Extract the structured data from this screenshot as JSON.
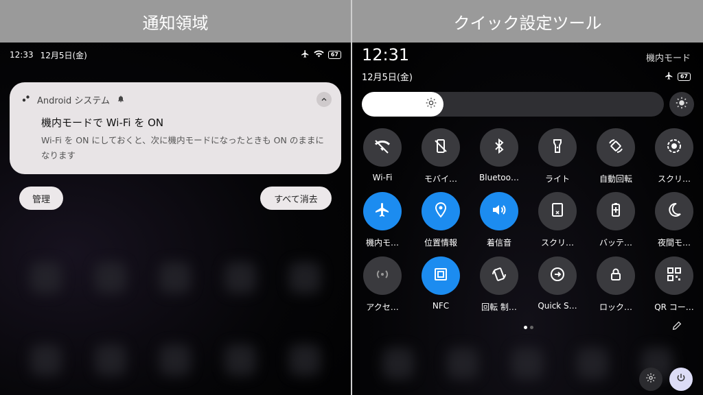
{
  "headers": {
    "left": "通知領域",
    "right": "クイック設定ツール"
  },
  "left_panel": {
    "status_bar": {
      "time": "12:33",
      "date": "12月5日(金)",
      "battery": "67"
    },
    "notification": {
      "app_name": "Android システム",
      "title": "機内モードで Wi-Fi を ON",
      "body": "Wi-Fi を ON にしておくと、次に機内モードになったときも ON のままになります"
    },
    "buttons": {
      "manage": "管理",
      "clear_all": "すべて消去"
    }
  },
  "right_panel": {
    "time": "12:31",
    "mode": "機内モード",
    "date": "12月5日(金)",
    "battery": "67",
    "brightness_level": 0.27,
    "tiles": [
      {
        "label": "Wi-Fi",
        "icon": "wifi-off-icon",
        "active": false
      },
      {
        "label": "モバイ…",
        "icon": "mobile-data-off-icon",
        "active": false
      },
      {
        "label": "Bluetoo…",
        "icon": "bluetooth-icon",
        "active": false
      },
      {
        "label": "ライト",
        "icon": "flashlight-icon",
        "active": false
      },
      {
        "label": "自動回転",
        "icon": "auto-rotate-icon",
        "active": false
      },
      {
        "label": "スクリ…",
        "icon": "screen-record-icon",
        "active": false
      },
      {
        "label": "機内モ…",
        "icon": "airplane-icon",
        "active": true
      },
      {
        "label": "位置情報",
        "icon": "location-icon",
        "active": true
      },
      {
        "label": "着信音",
        "icon": "sound-icon",
        "active": true
      },
      {
        "label": "スクリ…",
        "icon": "screenshot-icon",
        "active": false
      },
      {
        "label": "バッテ…",
        "icon": "battery-saver-icon",
        "active": false
      },
      {
        "label": "夜間モ…",
        "icon": "night-mode-icon",
        "active": false
      },
      {
        "label": "アクセ…",
        "icon": "hotspot-icon",
        "active": false
      },
      {
        "label": "NFC",
        "icon": "nfc-icon",
        "active": true
      },
      {
        "label": "回転 制…",
        "icon": "rotation-lock-icon",
        "active": false
      },
      {
        "label": "Quick S…",
        "icon": "quick-share-icon",
        "active": false
      },
      {
        "label": "ロック…",
        "icon": "lock-icon",
        "active": false
      },
      {
        "label": "QR コー…",
        "icon": "qr-code-icon",
        "active": false
      }
    ]
  },
  "colors": {
    "accent": "#1c8cf0",
    "tile_off": "#3a3a3e",
    "header_bg": "#9a9a9a",
    "card_bg": "#e8e4e6"
  }
}
